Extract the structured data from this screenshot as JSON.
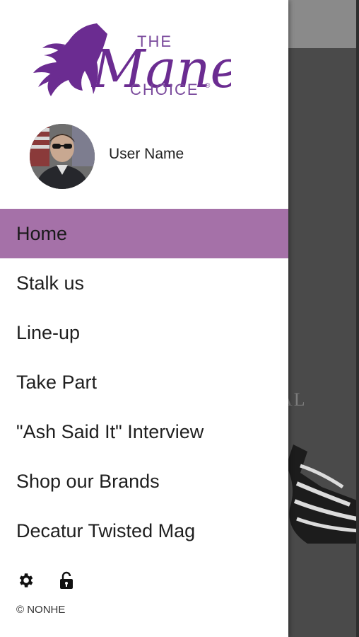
{
  "app": {
    "logo": {
      "word_the": "THE",
      "word_mane": "Mane",
      "word_choice": "CHOICE",
      "reg_mark": "®"
    }
  },
  "profile": {
    "user_name": "User Name"
  },
  "menu": {
    "items": [
      {
        "label": "Home",
        "active": true
      },
      {
        "label": "Stalk us",
        "active": false
      },
      {
        "label": "Line-up",
        "active": false
      },
      {
        "label": "Take Part",
        "active": false
      },
      {
        "label": "\"Ash Said It\" Interview",
        "active": false
      },
      {
        "label": "Shop our Brands",
        "active": false
      },
      {
        "label": "Decatur Twisted Mag",
        "active": false
      }
    ]
  },
  "footer": {
    "icons": [
      "gear-icon",
      "unlock-icon"
    ],
    "copyright": "© NONHE"
  },
  "background": {
    "partial_text": "AL"
  },
  "colors": {
    "brand_purple": "#6b2c91",
    "active_item_bg": "#a571a8",
    "toolbar_gray": "#8a8a8a",
    "content_dark": "#4a4a4a"
  }
}
